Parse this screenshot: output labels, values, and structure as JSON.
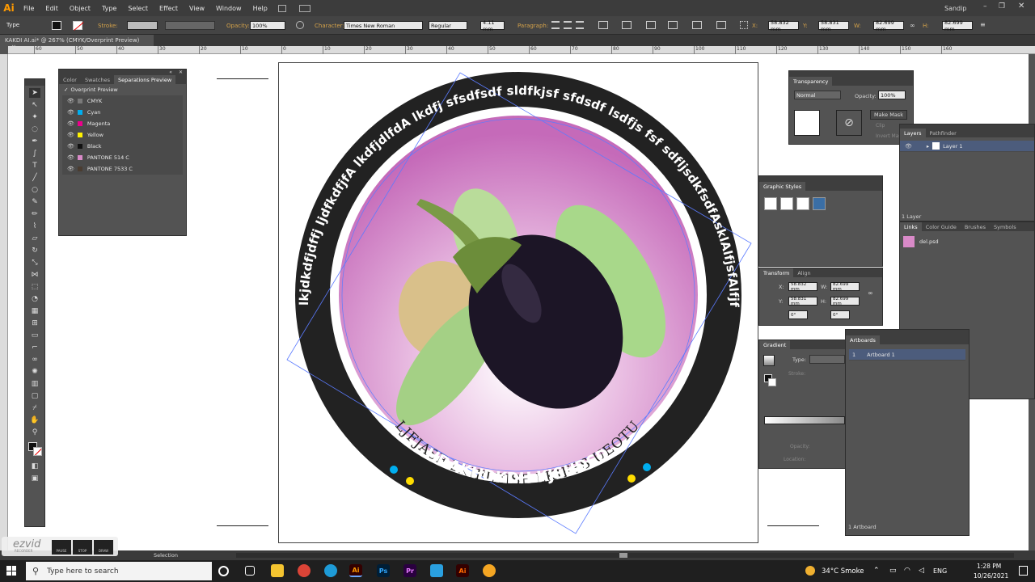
{
  "app": {
    "logo": "Ai",
    "user": "Sandip"
  },
  "menu": [
    "File",
    "Edit",
    "Object",
    "Type",
    "Select",
    "Effect",
    "View",
    "Window",
    "Help"
  ],
  "control": {
    "tool_label": "Type",
    "stroke_label": "Stroke:",
    "opacity_label": "Opacity:",
    "opacity_value": "100%",
    "character_label": "Character:",
    "font_family": "Times New Roman",
    "font_style": "Regular",
    "font_size": "4.11 mm",
    "paragraph_label": "Paragraph:",
    "x_label": "X:",
    "x_value": "58.832 mm",
    "y_label": "Y:",
    "y_value": "58.831 mm",
    "w_label": "W:",
    "w_value": "82.699 mm",
    "h_label": "H:",
    "h_value": "82.699 mm"
  },
  "doc_tab": {
    "title": "KAKDI AI.ai* @ 267% (CMYK/Overprint Preview)",
    "close": "×"
  },
  "ruler_ticks": [
    "60",
    "50",
    "40",
    "30",
    "20",
    "10",
    "0",
    "10",
    "20",
    "30",
    "40",
    "50",
    "60",
    "70",
    "80",
    "90",
    "100",
    "110",
    "120",
    "130",
    "140",
    "150",
    "160"
  ],
  "separations": {
    "tabs": [
      "Color",
      "Swatches",
      "Separations Preview"
    ],
    "overprint_label": "Overprint Preview",
    "rows": [
      {
        "name": "CMYK",
        "color": "#7a7a7a"
      },
      {
        "name": "Cyan",
        "color": "#00aeef"
      },
      {
        "name": "Magenta",
        "color": "#ec008c"
      },
      {
        "name": "Yellow",
        "color": "#fff200"
      },
      {
        "name": "Black",
        "color": "#111111"
      },
      {
        "name": "PANTONE 514 C",
        "color": "#d98ac8"
      },
      {
        "name": "PANTONE 7533 C",
        "color": "#4a3c30"
      }
    ]
  },
  "badge": {
    "top_text": "lkjdkdfjdffj ljdfkdfjfA lkdfjdlfdA lkdfj sfsdfsdf sldfkjsf sfdsdf lsdfjs fsf sdfljsdkfsdfAsklAlfjsfAlfjfAfjf",
    "mid_text": "LJFJASF LKJFLFJSF LKJFFS UEOTU",
    "bottom_text": "HDAKHDKDH KJSHDSD",
    "colors": {
      "ring": "#222222",
      "inner": "#d98ac8",
      "dot_yellow": "#ffdd00",
      "dot_cyan": "#00aeef"
    }
  },
  "transparency": {
    "title": "Transparency",
    "blend": "Normal",
    "opacity_label": "Opacity:",
    "opacity": "100%",
    "make_mask": "Make Mask",
    "clip": "Clip",
    "invert_mask": "Invert Mask"
  },
  "layers": {
    "tabs": [
      "Layers",
      "Pathfinder"
    ],
    "layer_name": "Layer 1",
    "count": "1 Layer"
  },
  "graphic_styles": {
    "title": "Graphic Styles"
  },
  "transform": {
    "tabs": [
      "Transform",
      "Align"
    ],
    "x_label": "X:",
    "x": "58.832 mm",
    "y_label": "Y:",
    "y": "58.831 mm",
    "w_label": "W:",
    "w": "82.699 mm",
    "h_label": "H:",
    "h": "82.699 mm",
    "angle1": "0°",
    "angle2": "0°"
  },
  "links": {
    "tabs": [
      "Links",
      "Color Guide",
      "Brushes",
      "Symbols"
    ],
    "file": "del.psd"
  },
  "gradient": {
    "title": "Gradient",
    "type_label": "Type:",
    "stroke_label": "Stroke:",
    "opacity_label": "Opacity:",
    "location_label": "Location:"
  },
  "artboards": {
    "title": "Artboards",
    "item_index": "1",
    "item_name": "Artboard 1",
    "count": "1 Artboard"
  },
  "status": {
    "tool": "Selection"
  },
  "recorder": {
    "brand": "ezvid",
    "sub": "RECORDER",
    "buttons": [
      "PAUSE",
      "STOP",
      "DRAW"
    ]
  },
  "taskbar": {
    "search_placeholder": "Type here to search",
    "weather": "34°C  Smoke",
    "lang": "ENG",
    "time": "1:28 PM",
    "date": "10/26/2021"
  }
}
